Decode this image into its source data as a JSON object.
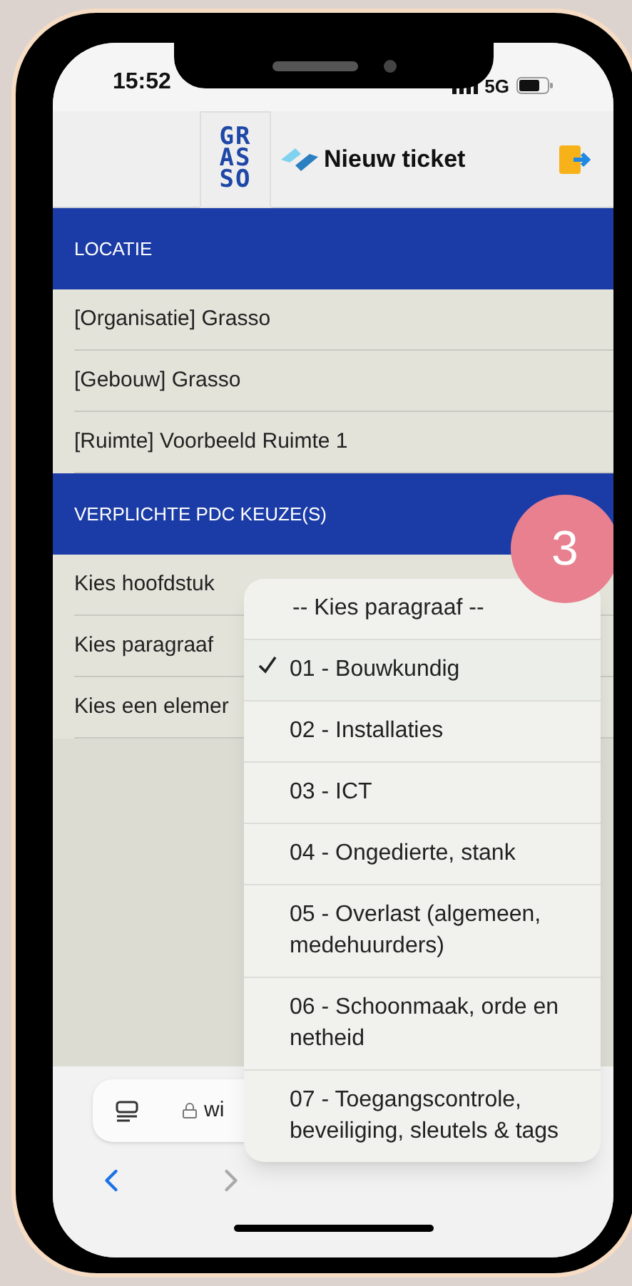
{
  "status_bar": {
    "time": "15:52",
    "network": "5G"
  },
  "header": {
    "logo_lines": [
      "GR",
      "AS",
      "SO"
    ],
    "title": "Nieuw ticket"
  },
  "sections": [
    {
      "title": "LOCATIE",
      "rows": [
        "[Organisatie] Grasso",
        "[Gebouw] Grasso",
        "[Ruimte] Voorbeeld Ruimte 1"
      ]
    },
    {
      "title": "VERPLICHTE PDC KEUZE(S)",
      "rows": [
        "Kies hoofdstuk",
        "Kies paragraaf",
        "Kies een elemer"
      ]
    }
  ],
  "badge": "3",
  "dropdown": {
    "options": [
      {
        "label": "-- Kies paragraaf --",
        "selected": false
      },
      {
        "label": "01 - Bouwkundig",
        "selected": true
      },
      {
        "label": "02 - Installaties",
        "selected": false
      },
      {
        "label": "03 - ICT",
        "selected": false
      },
      {
        "label": "04 - Ongedierte, stank",
        "selected": false
      },
      {
        "label": "05 - Overlast (algemeen, medehuurders)",
        "selected": false
      },
      {
        "label": "06 - Schoonmaak, orde en netheid",
        "selected": false
      },
      {
        "label": "07 - Toegangscontrole, beveiliging, sleutels & tags",
        "selected": false
      }
    ]
  },
  "browser": {
    "url": "wi"
  }
}
